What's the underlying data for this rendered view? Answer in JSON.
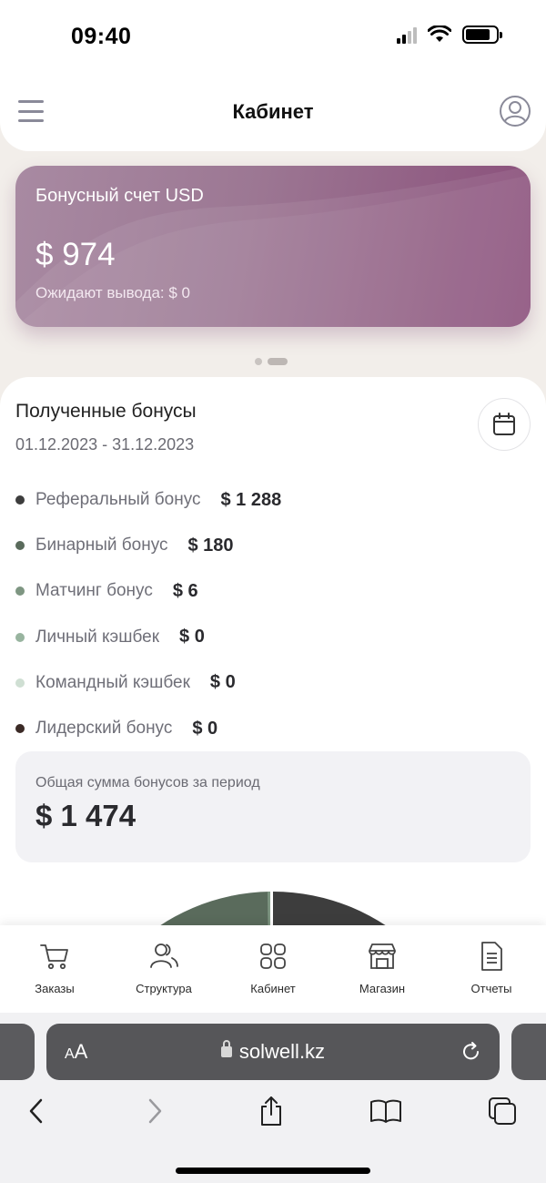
{
  "status_bar": {
    "time": "09:40"
  },
  "header": {
    "title": "Кабинет",
    "menu_icon": "hamburger-icon",
    "profile_icon": "user-circle-icon"
  },
  "bonus_card": {
    "title": "Бонусный счет USD",
    "amount": "$ 974",
    "pending": "Ожидают вывода: $ 0",
    "gradient_colors": [
      "#a88aa2",
      "#8a4e7a"
    ]
  },
  "carousel": {
    "pages": 2,
    "active": 2
  },
  "bonuses": {
    "title": "Полученные бонусы",
    "period": "01.12.2023 - 31.12.2023",
    "items": [
      {
        "label": "Реферальный бонус",
        "value": "$ 1 288",
        "color": "#3d3d3d"
      },
      {
        "label": "Бинарный бонус",
        "value": "$ 180",
        "color": "#5a6b5c"
      },
      {
        "label": "Матчинг бонус",
        "value": "$ 6",
        "color": "#7e9682"
      },
      {
        "label": "Личный кэшбек",
        "value": "$ 0",
        "color": "#98b49f"
      },
      {
        "label": "Командный кэшбек",
        "value": "$ 0",
        "color": "#cfdfd3"
      },
      {
        "label": "Лидерский бонус",
        "value": "$ 0",
        "color": "#3b2a26"
      }
    ],
    "total_label": "Общая сумма бонусов за период",
    "total_amount": "$ 1 474"
  },
  "bottom_nav": [
    {
      "label": "Заказы",
      "icon": "cart-icon"
    },
    {
      "label": "Структура",
      "icon": "users-icon"
    },
    {
      "label": "Кабинет",
      "icon": "grid-icon"
    },
    {
      "label": "Магазин",
      "icon": "store-icon"
    },
    {
      "label": "Отчеты",
      "icon": "document-icon"
    }
  ],
  "browser": {
    "aa_small": "A",
    "aa_big": "A",
    "url": "solwell.kz"
  }
}
